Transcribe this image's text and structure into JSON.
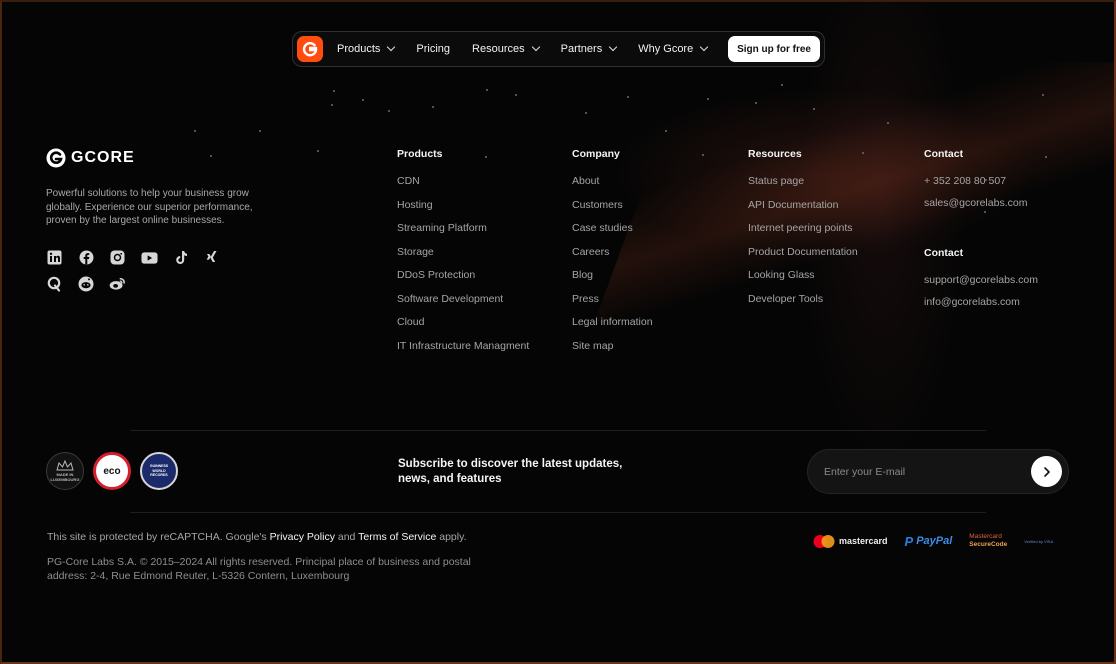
{
  "nav": {
    "items": [
      {
        "label": "Products",
        "dropdown": true
      },
      {
        "label": "Pricing",
        "dropdown": false
      },
      {
        "label": "Resources",
        "dropdown": true
      },
      {
        "label": "Partners",
        "dropdown": true
      },
      {
        "label": "Why Gcore",
        "dropdown": true
      }
    ],
    "signup_label": "Sign up for free"
  },
  "brand": {
    "name": "GCORE",
    "tagline": "Powerful solutions to help your business grow globally. Experience our superior performance, proven by the largest online businesses."
  },
  "social_icons": [
    "linkedin-icon",
    "facebook-icon",
    "instagram-icon",
    "youtube-icon",
    "tiktok-icon",
    "xing-icon",
    "quora-icon",
    "reddit-icon",
    "weibo-icon"
  ],
  "columns": {
    "products": {
      "title": "Products",
      "links": [
        "CDN",
        "Hosting",
        "Streaming Platform",
        "Storage",
        "DDoS Protection",
        "Software Development",
        "Cloud",
        "IT Infrastructure Managment"
      ]
    },
    "company": {
      "title": "Company",
      "links": [
        "About",
        "Customers",
        "Case studies",
        "Careers",
        "Blog",
        "Press",
        "Legal information",
        "Site map"
      ]
    },
    "resources": {
      "title": "Resources",
      "links": [
        "Status page",
        "API Documentation",
        "Internet peering points",
        "Product Documentation",
        "Looking Glass",
        "Developer Tools"
      ]
    },
    "contact1": {
      "title": "Contact",
      "links": [
        "+ 352 208 80 507",
        "sales@gcorelabs.com"
      ]
    },
    "contact2": {
      "title": "Contact",
      "links": [
        "support@gcorelabs.com",
        "info@gcorelabs.com"
      ]
    }
  },
  "badges": [
    {
      "name": "made-in-luxembourg-badge",
      "text": "MADE IN LUXEMBOURG"
    },
    {
      "name": "eco-badge",
      "text": "eco"
    },
    {
      "name": "guinness-badge",
      "text": "GUINNESS WORLD RECORDS"
    }
  ],
  "subscribe": {
    "heading": "Subscribe to discover the latest updates, news, and features",
    "placeholder": "Enter your E-mail"
  },
  "legal": {
    "recaptcha_prefix": "This site is protected by reCAPTCHA. Google's",
    "privacy_label": "Privacy Policy",
    "and_text": "and",
    "terms_label": "Terms of Service",
    "apply_text": "apply.",
    "copyright": "PG-Core Labs S.A. © 2015–2024 All rights reserved. Principal place of business and postal address: 2-4, Rue Edmond Reuter, L-5326 Contern, Luxembourg"
  },
  "payments": {
    "mastercard": "mastercard",
    "paypal": "PayPal",
    "securecode_line1": "Mastercard",
    "securecode_line2": "SecureCode",
    "verified": "Verified by VISA"
  },
  "colors": {
    "accent": "#ff4d12",
    "background": "#050505",
    "frame": "#6a3516"
  }
}
